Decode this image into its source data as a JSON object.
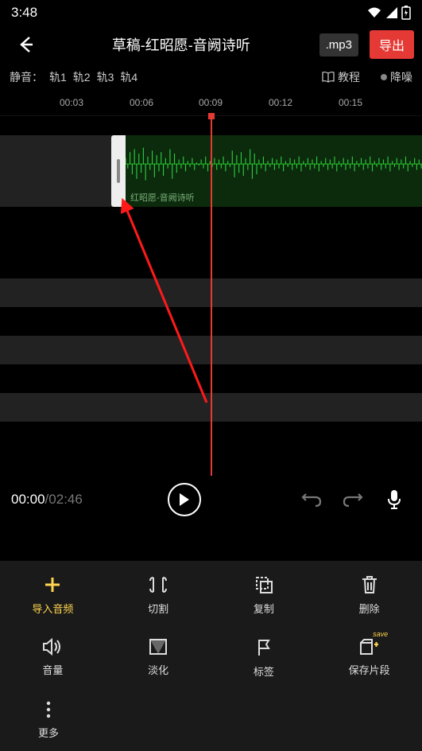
{
  "status": {
    "time": "3:48"
  },
  "header": {
    "title": "草稿-红昭愿-音阙诗听",
    "format": ".mp3",
    "export": "导出"
  },
  "track_row": {
    "mute_label": "静音：",
    "tracks": [
      "轨1",
      "轨2",
      "轨3",
      "轨4"
    ],
    "tutorial": "教程",
    "denoise": "降噪"
  },
  "ruler": [
    "00:03",
    "00:06",
    "00:09",
    "00:12",
    "00:15"
  ],
  "clip": {
    "label": "红昭愿-音阙诗听"
  },
  "transport": {
    "current": "00:00",
    "sep": " / ",
    "total": "02:46"
  },
  "tools": {
    "import": "导入音频",
    "cut": "切割",
    "copy": "复制",
    "delete": "删除",
    "volume": "音量",
    "fade": "淡化",
    "tag": "标签",
    "save_clip": "保存片段",
    "save_badge": "save",
    "more": "更多"
  }
}
